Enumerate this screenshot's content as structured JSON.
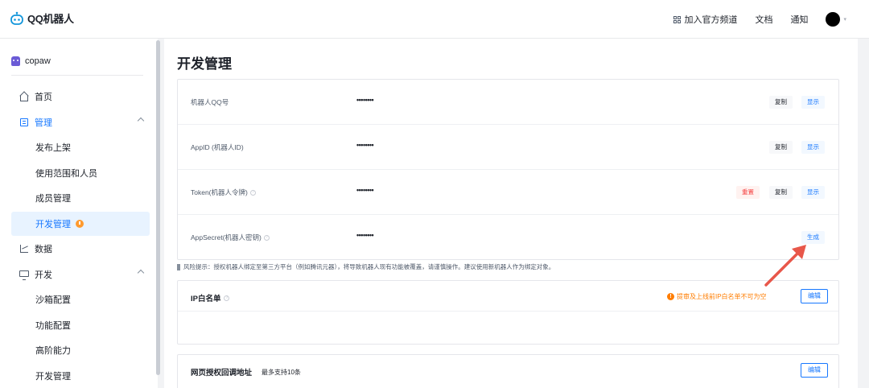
{
  "header": {
    "logo_text": "QQ机器人",
    "links": {
      "channel": "加入官方频道",
      "docs": "文档",
      "notify": "通知"
    }
  },
  "sidebar": {
    "bot_name": "copaw",
    "items": {
      "home": "首页",
      "manage": "管理",
      "publish": "发布上架",
      "scope": "使用范围和人员",
      "members": "成员管理",
      "devmanage": "开发管理",
      "data": "数据",
      "dev": "开发",
      "sandbox": "沙箱配置",
      "feature": "功能配置",
      "advanced": "高阶能力",
      "devmanage2": "开发管理"
    }
  },
  "main": {
    "title": "开发管理",
    "credentials": [
      {
        "label": "机器人QQ号",
        "value": "••••••••",
        "copy": "复制",
        "show": "显示"
      },
      {
        "label": "AppID (机器人ID)",
        "value": "••••••••",
        "copy": "复制",
        "show": "显示"
      },
      {
        "label": "Token(机器人令牌)",
        "value": "••••••••",
        "reset": "重置",
        "copy": "复制",
        "show": "显示"
      },
      {
        "label": "AppSecret(机器人密钥)",
        "value": "••••••••",
        "generate": "生成"
      }
    ],
    "risk_note": "风险提示：授权机器人绑定至第三方平台（例如腾讯元器），将导致机器人现有功能被覆盖，请谨慎操作。建议使用新机器人作为绑定对象。",
    "ip_whitelist": {
      "title": "IP白名单",
      "warning": "提审及上线前IP白名单不可为空",
      "edit": "编辑"
    },
    "web_callback": {
      "title": "网页授权回调地址",
      "sub": "最多支持10条",
      "edit": "编辑"
    }
  },
  "colors": {
    "accent": "#1677ff",
    "warning": "#ff7d00",
    "danger": "#f53f3f",
    "annotation_arrow": "#e8574a"
  }
}
